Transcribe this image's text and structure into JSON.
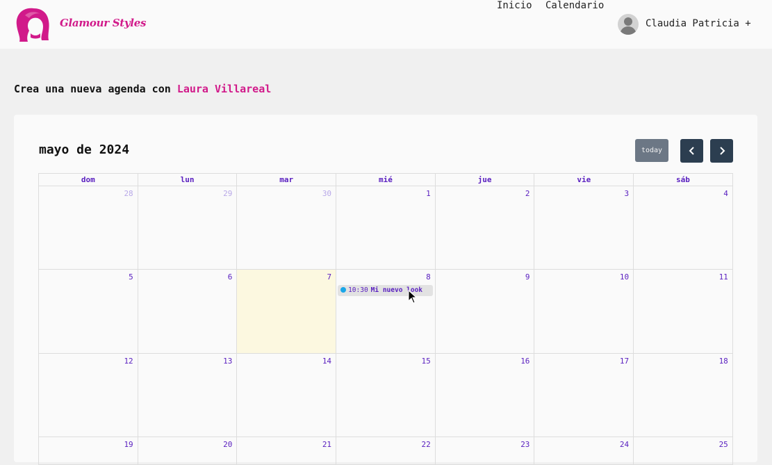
{
  "navbar": {
    "brand": "Glamour Styles",
    "links": [
      {
        "label": "Inicio"
      },
      {
        "label": "Calendario"
      }
    ],
    "user": {
      "name": "Claudia Patricia +"
    }
  },
  "page": {
    "heading_prefix": "Crea una nueva agenda con ",
    "stylist_name": "Laura Villareal"
  },
  "calendar": {
    "title": "mayo de 2024",
    "today_label": "today",
    "prev_icon": "chevron-left-icon",
    "next_icon": "chevron-right-icon",
    "weekdays": [
      "dom",
      "lun",
      "mar",
      "mié",
      "jue",
      "vie",
      "sáb"
    ],
    "weeks": [
      [
        {
          "day": "28",
          "other_month": true
        },
        {
          "day": "29",
          "other_month": true
        },
        {
          "day": "30",
          "other_month": true
        },
        {
          "day": "1"
        },
        {
          "day": "2"
        },
        {
          "day": "3"
        },
        {
          "day": "4"
        }
      ],
      [
        {
          "day": "5"
        },
        {
          "day": "6"
        },
        {
          "day": "7",
          "today": true
        },
        {
          "day": "8",
          "events": [
            {
              "time": "10:30",
              "title": "Mi nuevo look"
            }
          ]
        },
        {
          "day": "9"
        },
        {
          "day": "10"
        },
        {
          "day": "11"
        }
      ],
      [
        {
          "day": "12"
        },
        {
          "day": "13"
        },
        {
          "day": "14"
        },
        {
          "day": "15"
        },
        {
          "day": "16"
        },
        {
          "day": "17"
        },
        {
          "day": "18"
        }
      ],
      [
        {
          "day": "19"
        },
        {
          "day": "20"
        },
        {
          "day": "21"
        },
        {
          "day": "22"
        },
        {
          "day": "23"
        },
        {
          "day": "24"
        },
        {
          "day": "25"
        }
      ]
    ]
  },
  "colors": {
    "brand": "#d11a8a",
    "calendar_text": "#5a20c0",
    "today_bg": "#fcf8e0",
    "nav_button": "#2c3e50",
    "today_button": "#6c7785",
    "event_dot": "#1aa6e8"
  }
}
